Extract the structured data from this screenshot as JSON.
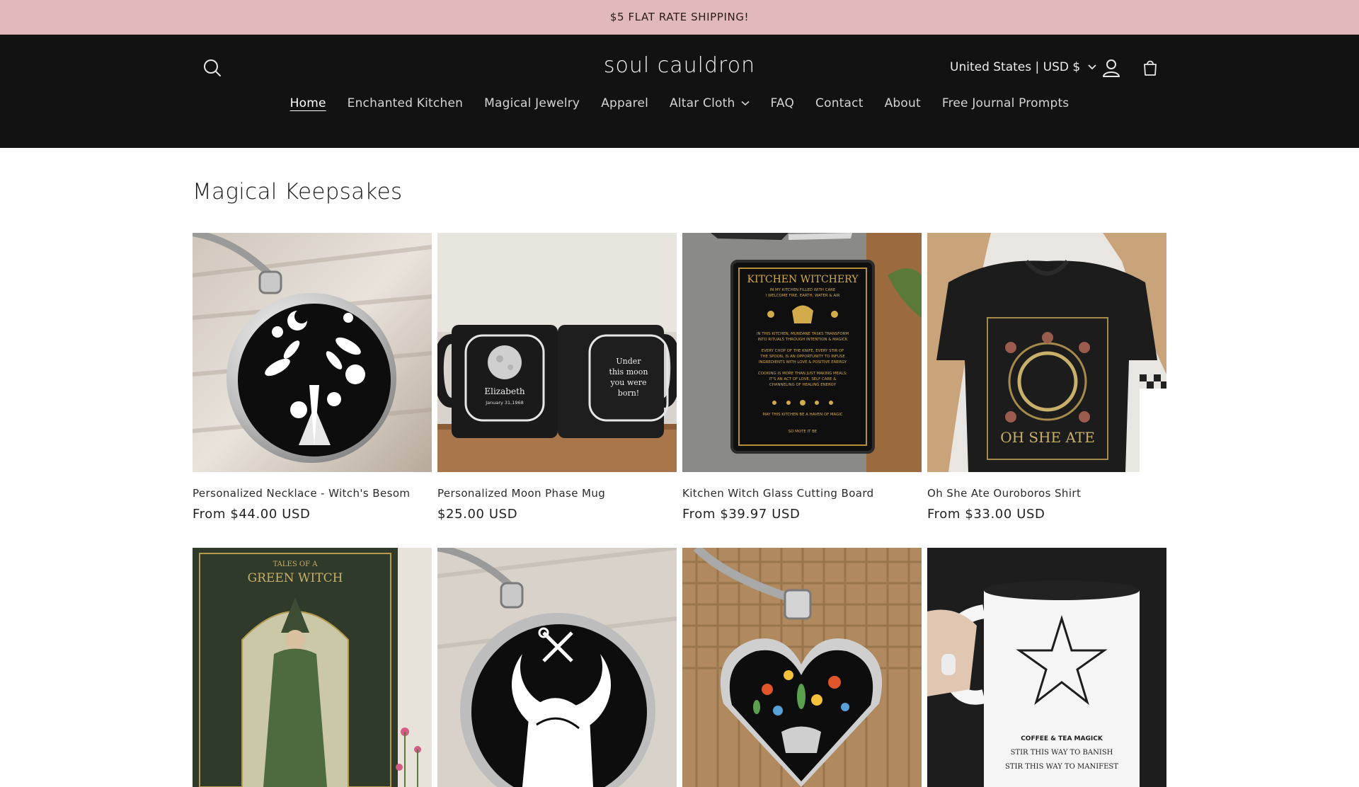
{
  "announcement": {
    "text": "$5 FLAT RATE SHIPPING!"
  },
  "header": {
    "logo": "soul cauldron",
    "locale": "United States | USD $",
    "icons": {
      "search": "search-icon",
      "account": "account-icon",
      "cart": "cart-icon",
      "chevron": "chevron-down-icon"
    }
  },
  "nav": {
    "items": [
      {
        "label": "Home",
        "active": true
      },
      {
        "label": "Enchanted Kitchen"
      },
      {
        "label": "Magical Jewelry"
      },
      {
        "label": "Apparel"
      },
      {
        "label": "Altar Cloth",
        "has_dropdown": true
      },
      {
        "label": "FAQ"
      },
      {
        "label": "Contact"
      },
      {
        "label": "About"
      },
      {
        "label": "Free Journal Prompts"
      }
    ]
  },
  "collection": {
    "title": "Magical Keepsakes",
    "products": [
      {
        "title": "Personalized Necklace - Witch's Besom",
        "price": "From $44.00 USD"
      },
      {
        "title": "Personalized Moon Phase Mug",
        "price": "$25.00 USD",
        "image_text": {
          "name": "Elizabeth",
          "date": "January 31,1968",
          "caption": [
            "Under",
            "this moon",
            "you were",
            "born!"
          ]
        }
      },
      {
        "title": "Kitchen Witch Glass Cutting Board",
        "price": "From $39.97 USD",
        "image_text": {
          "heading": "KITCHEN WITCHERY",
          "lines": [
            "IN MY KITCHEN FILLED WITH CARE",
            "I WELCOME FIRE, EARTH, WATER & AIR",
            "IN THIS KITCHEN, MUNDANE TASKS TRANSFORM",
            "INTO RITUALS THROUGH INTENTION & MAGICK",
            "EVERY CHOP OF THE KNIFE, EVERY STIR OF",
            "THE SPOON, IS AN OPPORTUNITY TO INFUSE",
            "INGREDIENTS WITH LOVE & POSITIVE ENERGY",
            "COOKING IS MORE THAN JUST MAKING MEALS;",
            "IT'S AN ACT OF LOVE, SELF CARE &",
            "CHANNELING OF HEALING ENERGY",
            "MAY THIS KITCHEN BE A HAVEN OF MAGIC",
            "SO MOTE IT BE"
          ]
        }
      },
      {
        "title": "Oh She Ate Ouroboros Shirt",
        "price": "From $33.00 USD",
        "image_text": {
          "caption": "OH SHE ATE"
        }
      },
      {
        "title": "",
        "price": "",
        "image_text": {
          "heading": [
            "TALES OF A",
            "GREEN WITCH"
          ]
        }
      },
      {
        "title": "",
        "price": ""
      },
      {
        "title": "",
        "price": ""
      },
      {
        "title": "",
        "price": "",
        "image_text": {
          "lines": [
            "COFFEE & TEA MAGICK",
            "STIR THIS WAY TO BANISH",
            "STIR THIS WAY TO MANIFEST"
          ]
        }
      }
    ]
  },
  "colors": {
    "announcement_bg": "#e2b9bb",
    "header_bg": "#121212",
    "page_bg": "#ffffff"
  }
}
